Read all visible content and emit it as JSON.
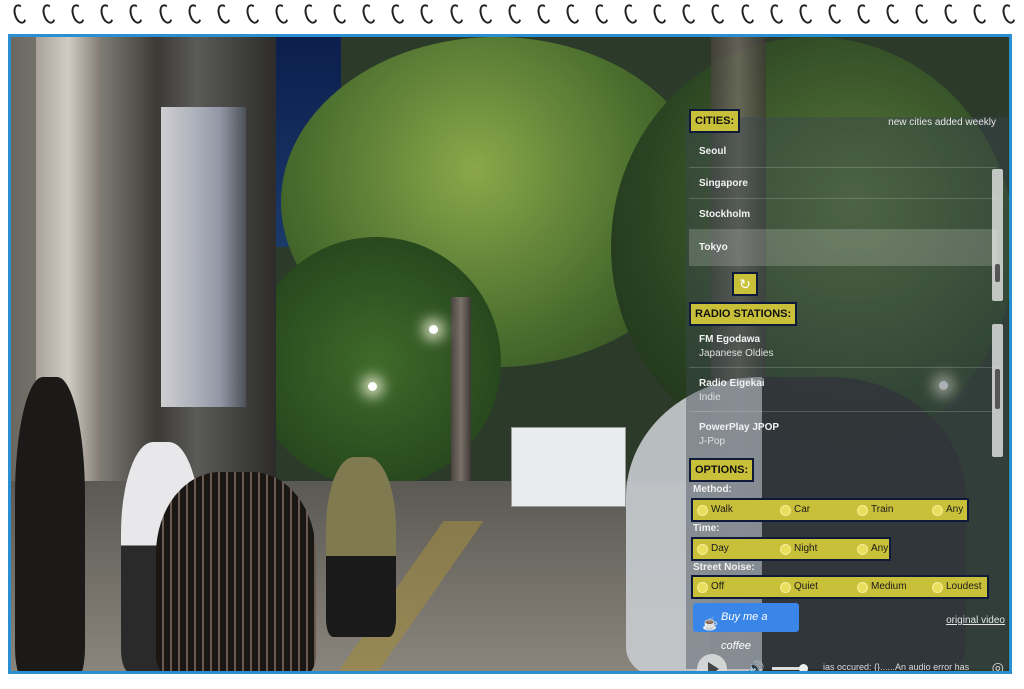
{
  "cities": {
    "header": "CITIES:",
    "note": "new cities added weekly",
    "items": [
      "Seoul",
      "Singapore",
      "Stockholm",
      "Tokyo"
    ],
    "active": "Tokyo",
    "refresh_icon": "refresh-icon"
  },
  "radio": {
    "header": "RADIO STATIONS:",
    "items": [
      {
        "name": "FM Egodawa",
        "genre": "Japanese Oldies"
      },
      {
        "name": "Radio Eigekai",
        "genre": "Indie"
      },
      {
        "name": "PowerPlay JPOP",
        "genre": "J-Pop"
      }
    ]
  },
  "options": {
    "header": "OPTIONS:",
    "method_label": "Method:",
    "method": [
      "Walk",
      "Car",
      "Train",
      "Any"
    ],
    "time_label": "Time:",
    "time": [
      "Day",
      "Night",
      "Any"
    ],
    "noise_label": "Street Noise:",
    "noise": [
      "Off",
      "Quiet",
      "Medium",
      "Loudest"
    ]
  },
  "coffee_label": "Buy me a coffee",
  "original_video_link": "original video",
  "player": {
    "status": "ias occured: {}......An audio error has"
  },
  "colors": {
    "highlight": "#c9c03a",
    "frame": "#2a8fd0",
    "coffee": "#3a86e8"
  }
}
